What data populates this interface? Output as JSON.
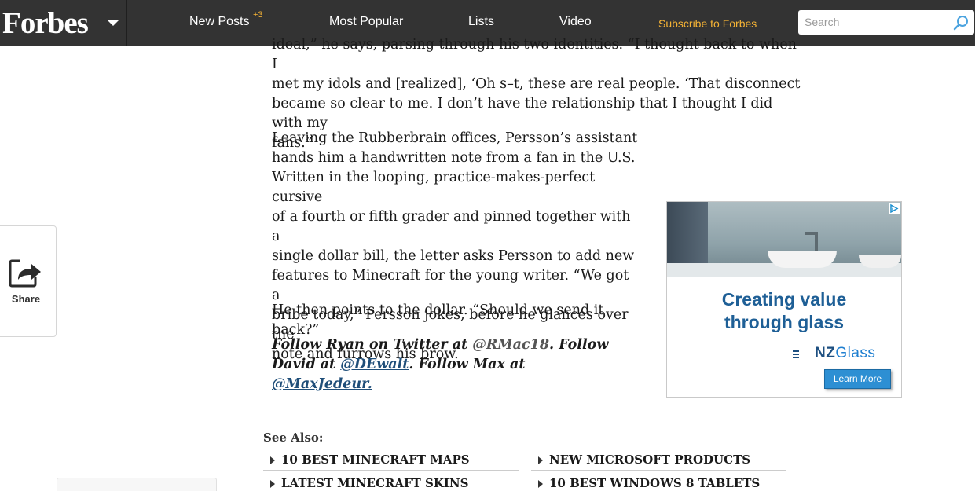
{
  "nav": {
    "logo": "Forbes",
    "new_posts": "New Posts",
    "new_posts_badge": "+3",
    "most_popular": "Most Popular",
    "lists": "Lists",
    "video": "Video",
    "subscribe": "Subscribe to Forbes",
    "search_placeholder": "Search"
  },
  "share": {
    "label": "Share"
  },
  "article": {
    "p_top": {
      "l1": "ideal,” he says, parsing through his two identities. “I thought back to when I",
      "l2": "met my idols and [realized], ‘Oh s–t, these are real people. ‘That disconnect",
      "l3": "became so clear to me. I don’t have the relationship that I thought I did with my",
      "l4": "fans.”"
    },
    "p_leaving": {
      "l1": "Leaving the Rubberbrain offices, Persson’s assistant",
      "l2": "hands him a handwritten note from a fan in the U.S.",
      "l3": "Written in the looping, practice-makes-perfect cursive",
      "l4": "of a fourth or fifth grader and pinned together with a",
      "l5": "single dollar bill, the letter asks Persson to add new",
      "l6": "features to Minecraft for the young writer. “We got a",
      "l7": "bribe today,” Persson jokes, before he glances over the",
      "l8": "note and furrows his brow."
    },
    "p_dollar": "He then points to the dollar. “Should we send it back?”",
    "follow": {
      "t1": "Follow Ryan on Twitter at ",
      "link1": "@RMac18",
      "t2": ". Follow",
      "t3": "David at ",
      "link2": "@DEwalt",
      "t4": ". Follow Max at",
      "link3": "@MaxJedeur."
    }
  },
  "ad": {
    "headline_1": "Creating value",
    "headline_2": "through glass",
    "brand_bold": "NZ",
    "brand_light": "Glass",
    "cta": "Learn More",
    "colors": {
      "headline": "#1e5f96",
      "cta": "#2d8fd3"
    }
  },
  "see_also": {
    "title": "See Also:",
    "items": [
      "10 Best Minecraft Maps",
      "New Microsoft Products",
      "Latest Minecraft Skins",
      "10 Best Windows 8 Tablets"
    ]
  }
}
